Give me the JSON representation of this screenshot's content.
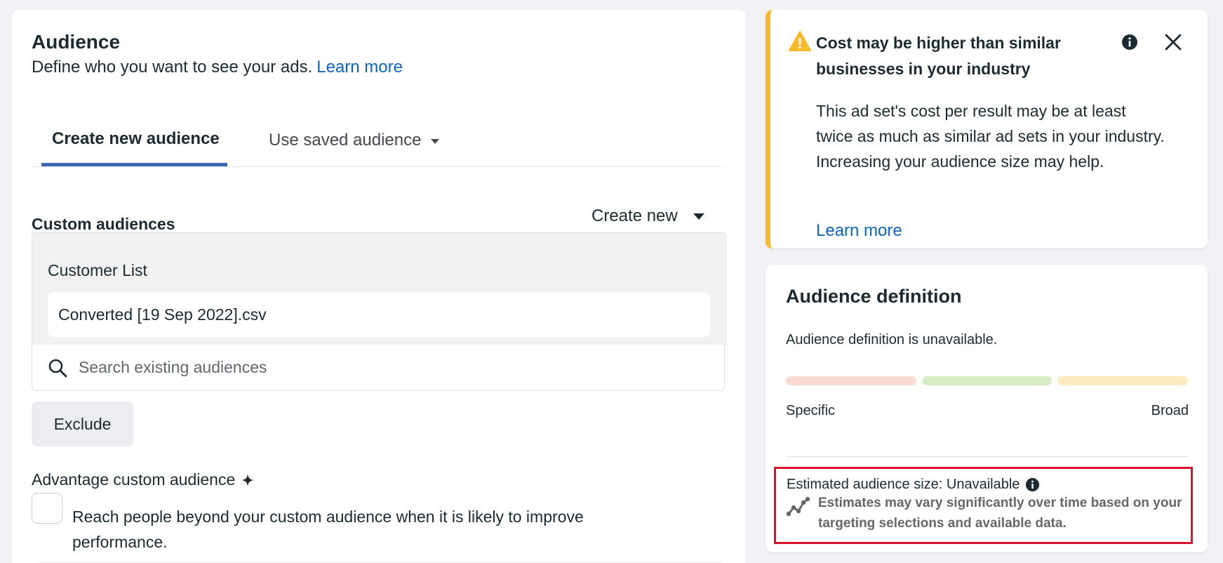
{
  "audience": {
    "title": "Audience",
    "subtitle": "Define who you want to see your ads.",
    "learn_more": "Learn more",
    "tabs": [
      {
        "label": "Create new audience",
        "active": true
      },
      {
        "label": "Use saved audience",
        "active": false
      }
    ],
    "custom_audiences": {
      "label": "Custom audiences",
      "create_new": "Create new",
      "list_title": "Customer List",
      "selected_file": "Converted [19 Sep 2022].csv",
      "search_placeholder": "Search existing audiences"
    },
    "exclude_button": "Exclude",
    "advantage": {
      "label": "Advantage custom audience",
      "description": "Reach people beyond your custom audience when it is likely to improve performance.",
      "checked": false
    }
  },
  "warning": {
    "title": "Cost may be higher than similar businesses in your industry",
    "body": "This ad set's cost per result may be at least twice as much as similar ad sets in your industry. Increasing your audience size may help.",
    "learn_more": "Learn more",
    "accent_color": "#f7b928"
  },
  "definition": {
    "title": "Audience definition",
    "status": "Audience definition is unavailable.",
    "scale_left": "Specific",
    "scale_right": "Broad",
    "estimated_size": "Estimated audience size: Unavailable",
    "estimate_note": "Estimates may vary significantly over time based on your targeting selections and available data.",
    "highlight_color": "#d8142a"
  },
  "colors": {
    "link": "#0a66c2",
    "tab_underline": "#4267b2"
  }
}
